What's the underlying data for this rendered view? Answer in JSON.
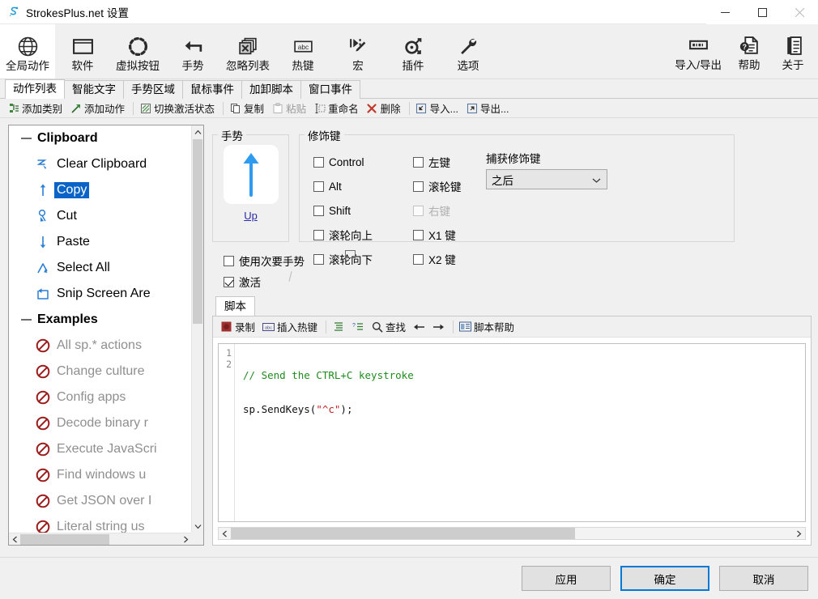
{
  "window": {
    "title": "StrokesPlus.net 设置",
    "app_icon": "strokesplus-logo-icon",
    "controls": {
      "minimize": "minimize-icon",
      "maximize": "maximize-icon",
      "close": "close-icon"
    }
  },
  "ribbon": {
    "items": [
      {
        "label": "全局动作",
        "icon": "globe-icon",
        "active": true
      },
      {
        "label": "软件",
        "icon": "window-icon",
        "active": false
      },
      {
        "label": "虚拟按钮",
        "icon": "dotted-circle-icon",
        "active": false
      },
      {
        "label": "手势",
        "icon": "arrow-stroke-icon",
        "active": false
      },
      {
        "label": "忽略列表",
        "icon": "windows-x-icon",
        "active": false
      },
      {
        "label": "热键",
        "icon": "abc-key-icon",
        "active": false
      },
      {
        "label": "宏",
        "icon": "macro-play-icon",
        "active": false
      },
      {
        "label": "插件",
        "icon": "plugin-node-icon",
        "active": false
      },
      {
        "label": "选项",
        "icon": "wrench-icon",
        "active": false
      }
    ],
    "right_items": [
      {
        "label": "导入/导出",
        "icon": "import-export-icon"
      },
      {
        "label": "帮助",
        "icon": "help-doc-icon"
      },
      {
        "label": "关于",
        "icon": "about-doc-icon"
      }
    ]
  },
  "tabs": [
    {
      "label": "动作列表",
      "active": true
    },
    {
      "label": "智能文字",
      "active": false
    },
    {
      "label": "手势区域",
      "active": false
    },
    {
      "label": "鼠标事件",
      "active": false
    },
    {
      "label": "加卸脚本",
      "active": false
    },
    {
      "label": "窗口事件",
      "active": false
    }
  ],
  "action_toolbar": [
    {
      "label": "添加类别",
      "icon": "add-category-icon",
      "disabled": false
    },
    {
      "label": "添加动作",
      "icon": "add-action-icon",
      "disabled": false
    },
    {
      "label": "切换激活状态",
      "icon": "toggle-active-icon",
      "disabled": false
    },
    {
      "label": "复制",
      "icon": "copy-icon",
      "disabled": false
    },
    {
      "label": "粘贴",
      "icon": "paste-icon",
      "disabled": true
    },
    {
      "label": "重命名",
      "icon": "rename-icon",
      "disabled": false
    },
    {
      "label": "删除",
      "icon": "delete-x-icon",
      "disabled": false
    },
    {
      "label": "导入...",
      "icon": "import-icon",
      "disabled": false
    },
    {
      "label": "导出...",
      "icon": "export-icon",
      "disabled": false
    }
  ],
  "tree": {
    "groups": [
      {
        "label": "Clipboard",
        "expander": "collapse-minus-icon",
        "children": [
          {
            "label": "Clear Clipboard",
            "icon": "gesture-zigzag-icon",
            "selected": false,
            "disabled": false
          },
          {
            "label": "Copy",
            "icon": "gesture-up-arrow-icon",
            "selected": true,
            "disabled": false
          },
          {
            "label": "Cut",
            "icon": "gesture-loop-icon",
            "selected": false,
            "disabled": false
          },
          {
            "label": "Paste",
            "icon": "gesture-down-arrow-icon",
            "selected": false,
            "disabled": false
          },
          {
            "label": "Select All",
            "icon": "gesture-caret-icon",
            "selected": false,
            "disabled": false
          },
          {
            "label": "Snip Screen Are",
            "icon": "gesture-rect-icon",
            "selected": false,
            "disabled": false
          }
        ]
      },
      {
        "label": "Examples",
        "expander": "collapse-minus-icon",
        "children": [
          {
            "label": "All sp.* actions",
            "icon": "disabled-circle-icon",
            "selected": false,
            "disabled": true
          },
          {
            "label": "Change culture",
            "icon": "disabled-circle-icon",
            "selected": false,
            "disabled": true
          },
          {
            "label": "Config apps",
            "icon": "disabled-circle-icon",
            "selected": false,
            "disabled": true
          },
          {
            "label": "Decode binary r",
            "icon": "disabled-circle-icon",
            "selected": false,
            "disabled": true
          },
          {
            "label": "Execute JavaScri",
            "icon": "disabled-circle-icon",
            "selected": false,
            "disabled": true
          },
          {
            "label": "Find windows u",
            "icon": "disabled-circle-icon",
            "selected": false,
            "disabled": true
          },
          {
            "label": "Get JSON over I",
            "icon": "disabled-circle-icon",
            "selected": false,
            "disabled": true
          },
          {
            "label": "Literal string us",
            "icon": "disabled-circle-icon",
            "selected": false,
            "disabled": true
          }
        ]
      }
    ]
  },
  "gesture_panel": {
    "title": "手势",
    "preview_icon": "up-arrow-gesture-icon",
    "link_label": "Up"
  },
  "modifiers": {
    "title": "修饰键",
    "column_left": [
      {
        "label": "Control",
        "checked": false,
        "disabled": false
      },
      {
        "label": "Alt",
        "checked": false,
        "disabled": false
      },
      {
        "label": "Shift",
        "checked": false,
        "disabled": false
      },
      {
        "label": "滚轮向上",
        "checked": false,
        "disabled": false
      },
      {
        "label": "滚轮向下",
        "checked": false,
        "disabled": false
      }
    ],
    "column_right": [
      {
        "label": "左键",
        "checked": false,
        "disabled": false
      },
      {
        "label": "滚轮键",
        "checked": false,
        "disabled": false
      },
      {
        "label": "右键",
        "checked": false,
        "disabled": true
      },
      {
        "label": "X1 键",
        "checked": false,
        "disabled": false
      },
      {
        "label": "X2 键",
        "checked": false,
        "disabled": false
      }
    ],
    "capture": {
      "label": "捕获修饰键",
      "value": "之后",
      "chevron": "chevron-down-icon"
    }
  },
  "options": [
    {
      "label": "使用次要手势",
      "checked": false,
      "disabled": false
    },
    {
      "label": "激活",
      "checked": true,
      "disabled": false
    }
  ],
  "script": {
    "tab_label": "脚本",
    "toolbar": [
      {
        "label": "录制",
        "icon": "record-icon"
      },
      {
        "label": "插入热键",
        "icon": "abc-key-icon"
      },
      {
        "label": "",
        "icon": "indent-icon"
      },
      {
        "label": "",
        "icon": "snippet-icon"
      },
      {
        "label": "查找",
        "icon": "search-icon"
      },
      {
        "label": "",
        "icon": "arrow-left-icon"
      },
      {
        "label": "",
        "icon": "arrow-right-icon"
      },
      {
        "label": "脚本帮助",
        "icon": "script-help-icon"
      }
    ],
    "lines": [
      {
        "number": "1",
        "tokens": [
          {
            "t": "// Send the CTRL+C keystroke",
            "c": "c-comment"
          }
        ]
      },
      {
        "number": "2",
        "tokens": [
          {
            "t": "sp.SendKeys(",
            "c": "c-ident"
          },
          {
            "t": "\"^c\"",
            "c": "c-str"
          },
          {
            "t": ");",
            "c": "c-punc"
          }
        ]
      }
    ]
  },
  "footer": {
    "apply": "应用",
    "ok": "确定",
    "cancel": "取消"
  }
}
